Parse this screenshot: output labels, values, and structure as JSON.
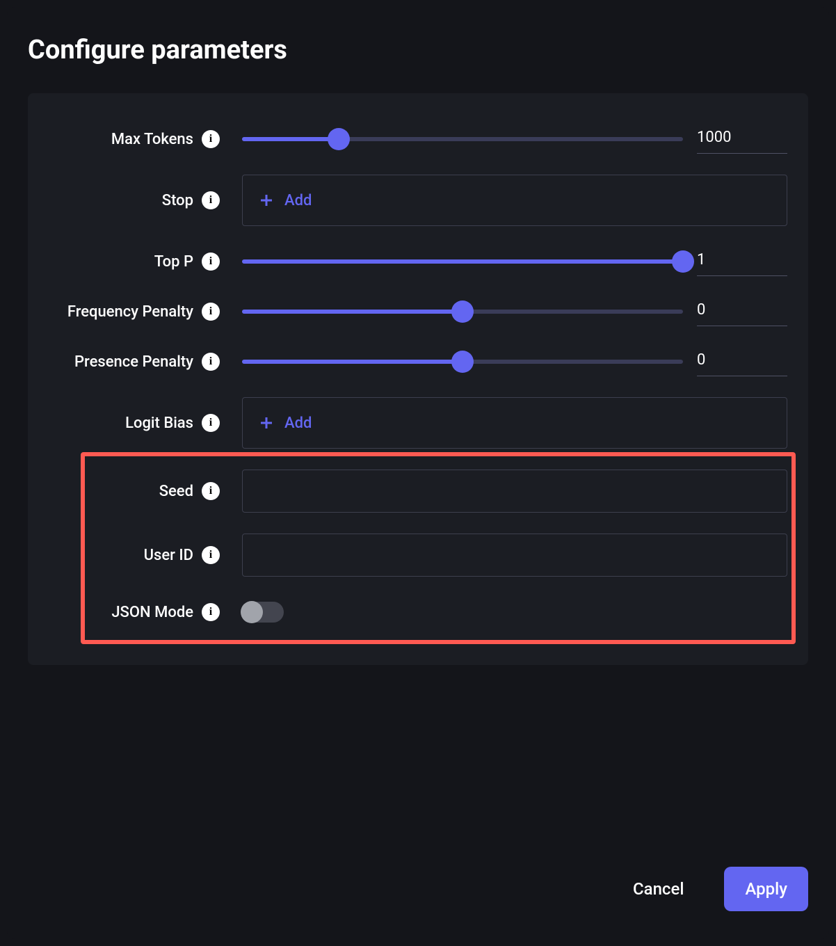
{
  "title": "Configure parameters",
  "params": {
    "max_tokens": {
      "label": "Max Tokens",
      "value": "1000",
      "fill_percent": 22
    },
    "stop": {
      "label": "Stop",
      "add_label": "Add"
    },
    "top_p": {
      "label": "Top P",
      "value": "1",
      "fill_percent": 100
    },
    "freq_pen": {
      "label": "Frequency Penalty",
      "value": "0",
      "fill_percent": 50
    },
    "pres_pen": {
      "label": "Presence Penalty",
      "value": "0",
      "fill_percent": 50
    },
    "logit_bias": {
      "label": "Logit Bias",
      "add_label": "Add"
    },
    "seed": {
      "label": "Seed",
      "value": ""
    },
    "user_id": {
      "label": "User ID",
      "value": ""
    },
    "json_mode": {
      "label": "JSON Mode",
      "enabled": false
    }
  },
  "buttons": {
    "cancel": "Cancel",
    "apply": "Apply"
  },
  "info_glyph": "i"
}
